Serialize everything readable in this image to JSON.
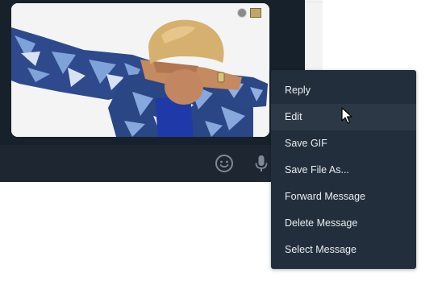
{
  "context_menu": {
    "items": [
      {
        "label": "Reply"
      },
      {
        "label": "Edit"
      },
      {
        "label": "Save GIF"
      },
      {
        "label": "Save File As..."
      },
      {
        "label": "Forward Message"
      },
      {
        "label": "Delete Message"
      },
      {
        "label": "Select Message"
      }
    ],
    "hovered_index": 1
  },
  "composer": {
    "icons": [
      "emoji-icon",
      "microphone-icon"
    ]
  },
  "gif": {
    "badges": [
      "gif-status-dot-icon",
      "gif-thumbnail-icon"
    ]
  },
  "colors": {
    "chat_background": "#17212b",
    "menu_background": "#232e3c",
    "menu_hover": "#2c3845",
    "menu_text": "#e9edf1"
  }
}
